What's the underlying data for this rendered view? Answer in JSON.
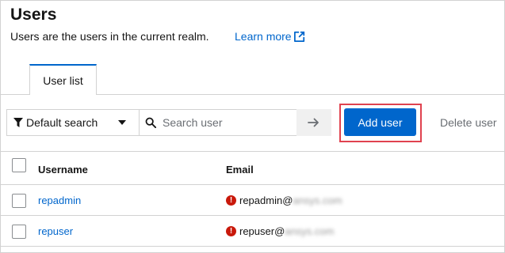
{
  "header": {
    "title": "Users",
    "subtitle": "Users are the users in the current realm.",
    "learn_more": "Learn more"
  },
  "tabs": [
    {
      "label": "User list",
      "active": true
    }
  ],
  "toolbar": {
    "search_type": "Default search",
    "search_placeholder": "Search user",
    "add_user_label": "Add user",
    "delete_user_label": "Delete user"
  },
  "table": {
    "columns": [
      "Username",
      "Email"
    ],
    "rows": [
      {
        "username": "repadmin",
        "email_user": "repadmin@",
        "email_domain": "ansys.com",
        "email_warning": true
      },
      {
        "username": "repuser",
        "email_user": "repuser@",
        "email_domain": "ansys.com",
        "email_warning": true
      }
    ]
  },
  "colors": {
    "primary": "#0066cc",
    "highlight": "#e0424f",
    "error": "#c9190b"
  }
}
